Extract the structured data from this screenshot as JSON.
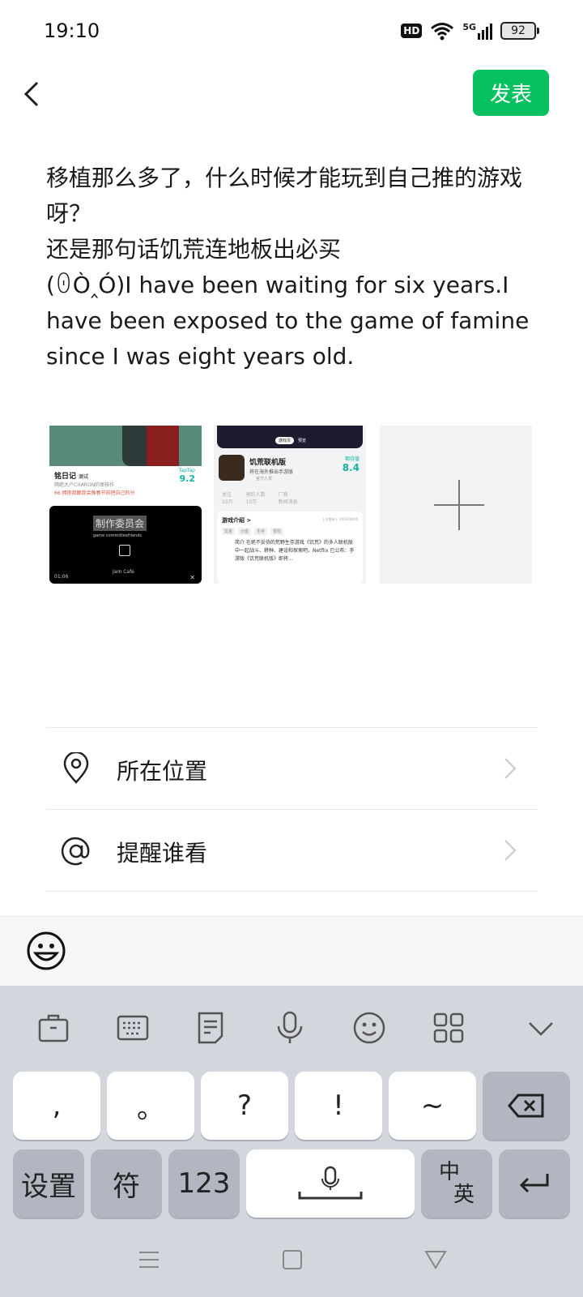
{
  "status_bar": {
    "time": "19:10",
    "hd": "HD",
    "network": "5G",
    "battery": "92"
  },
  "header": {
    "publish_label": "发表"
  },
  "post": {
    "text": "移植那么多了，什么时候才能玩到自己推的游戏呀？\n还是那句话饥荒连地板出必买\n(ꏿÒ‸Ó)I have been waiting for six years.I have been exposed to the game of famine since I was eight years old."
  },
  "thumbnails": {
    "t1": {
      "name": "铭日记",
      "tag": "测试",
      "score_label": "TapTap",
      "score": "9.2",
      "subtitle": "隔绝大户CHARON的审核作",
      "quote": "66 拥抱我跟我会像春节前把自己的分",
      "video_title": "制作委员会",
      "video_sub": "game committeefriends",
      "video_caption": "Jam Cafe",
      "video_time": "01:06"
    },
    "t2": {
      "tabs": [
        "游戏页",
        "预览"
      ],
      "app_name": "饥荒联机版",
      "app_sub": "将在海外推出手游版",
      "app_meta": "官方人员",
      "score_label": "期待值",
      "score": "8.4",
      "stats": [
        {
          "value": "10万",
          "label": "关注"
        },
        {
          "value": "10万",
          "label": "预约人数"
        },
        {
          "value": "新闻消息",
          "label": "厂商"
        }
      ],
      "section": "游戏介绍 >",
      "updated": "上次更新于 2024/06/06",
      "chips": [
        "饥荒",
        "沙盒",
        "生存",
        "冒险"
      ],
      "desc": "简介 在绝不妥协的荒野生存游戏《饥荒》的多人联机版中一起战斗、耕种、建设和探索吧。Netflix 已公布：手游版《饥荒联机版》即将..."
    }
  },
  "rows": [
    {
      "label": "所在位置",
      "icon": "location-pin-icon"
    },
    {
      "label": "提醒谁看",
      "icon": "at-icon"
    }
  ],
  "keyboard": {
    "toolbar": [
      "toolbox-icon",
      "keyboard-icon",
      "clipboard-icon",
      "mic-icon",
      "emoji-icon",
      "apps-grid-icon",
      "collapse-icon"
    ],
    "row1": [
      ",",
      "。",
      "?",
      "!",
      "~"
    ],
    "row2": {
      "settings": "设置",
      "symbols": "符",
      "numbers": "123",
      "lang_top": "中",
      "lang_bottom": "英"
    }
  }
}
